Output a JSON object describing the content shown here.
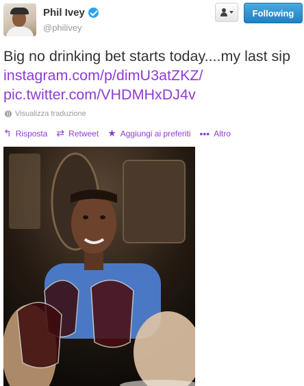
{
  "header": {
    "display_name": "Phil Ivey",
    "username": "@philivey",
    "following_label": "Following"
  },
  "tweet": {
    "text": "Big no drinking bet starts today....my last sip ",
    "link_instagram": "instagram.com/p/dimU3atZKZ/",
    "link_twitter": "pic.twitter.com/VHDMHxDJ4v",
    "translate_label": "Visualizza traduzione"
  },
  "actions": [
    {
      "label": "Risposta",
      "icon": "reply-icon"
    },
    {
      "label": "Retweet",
      "icon": "retweet-icon"
    },
    {
      "label": "Aggiungi ai preferiti",
      "icon": "star-icon"
    },
    {
      "label": "Altro",
      "icon": "more-icon"
    }
  ],
  "colors": {
    "link": "#8e3bd5",
    "following_button": "#2a8fd4",
    "verified_badge": "#2aa3ef"
  }
}
